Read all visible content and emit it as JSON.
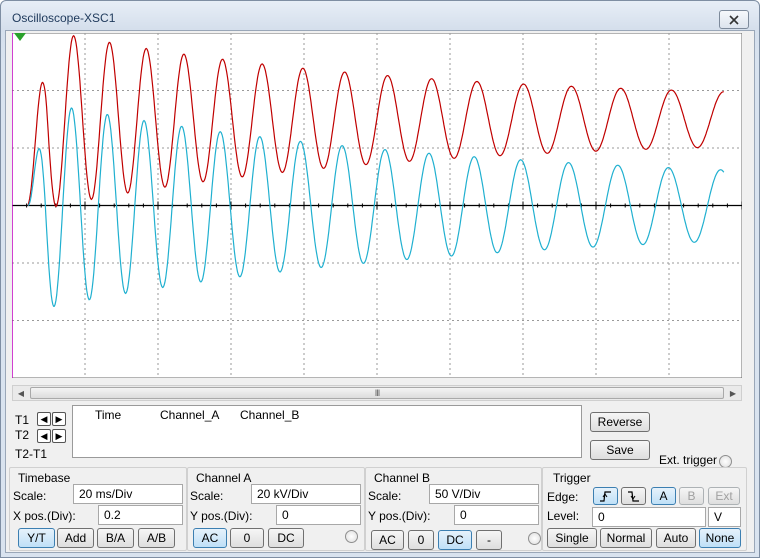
{
  "window": {
    "title": "Oscilloscope-XSC1"
  },
  "colors": {
    "channel_a": "#c00000",
    "channel_b": "#20b0d0",
    "trigger_marker": "#c000c0",
    "grid": "#9a9a9a",
    "screen_bg": "#ffffff"
  },
  "cursors": {
    "t1_label": "T1",
    "t2_label": "T2",
    "t2t1_label": "T2-T1"
  },
  "readout": {
    "col_time": "Time",
    "col_channel_a": "Channel_A",
    "col_channel_b": "Channel_B"
  },
  "buttons": {
    "reverse": "Reverse",
    "save": "Save",
    "ext_trigger": "Ext. trigger"
  },
  "timebase": {
    "title": "Timebase",
    "scale_label": "Scale:",
    "scale_value": "20 ms/Div",
    "xpos_label": "X pos.(Div):",
    "xpos_value": "0.2",
    "modes": [
      "Y/T",
      "Add",
      "B/A",
      "A/B"
    ],
    "active_mode": "Y/T"
  },
  "channel_a": {
    "title": "Channel A",
    "scale_label": "Scale:",
    "scale_value": "20 kV/Div",
    "ypos_label": "Y pos.(Div):",
    "ypos_value": "0",
    "coupling": [
      "AC",
      "0",
      "DC"
    ],
    "active_coupling": "AC"
  },
  "channel_b": {
    "title": "Channel B",
    "scale_label": "Scale:",
    "scale_value": "50  V/Div",
    "ypos_label": "Y pos.(Div):",
    "ypos_value": "0",
    "coupling": [
      "AC",
      "0",
      "DC",
      "-"
    ],
    "active_coupling": "DC"
  },
  "trigger": {
    "title": "Trigger",
    "edge_label": "Edge:",
    "level_label": "Level:",
    "level_value": "0",
    "level_unit": "V",
    "edge_rising_icon": "rising-edge-icon",
    "edge_falling_icon": "falling-edge-icon",
    "sources": [
      "A",
      "B",
      "Ext"
    ],
    "active_source": "A",
    "modes": [
      "Single",
      "Normal",
      "Auto",
      "None"
    ],
    "active_mode": "None"
  },
  "scrollbar": {
    "grip": "III"
  },
  "icons": {
    "close": "close-icon",
    "left_arrow": "arrow-left-icon",
    "right_arrow": "arrow-right-icon"
  },
  "chart_data": {
    "type": "line",
    "title": "",
    "xlabel": "",
    "ylabel": "",
    "grid": true,
    "x_divisions": 10,
    "y_divisions": 6,
    "series": [
      {
        "name": "Channel_A",
        "color": "#c00000",
        "description_points": {
          "x_div": [
            0.22,
            0.55,
            0.9,
            1.3,
            1.55,
            1.95,
            2.2,
            2.6,
            2.85,
            3.25,
            3.5,
            3.9,
            4.15,
            4.55,
            4.8,
            5.2,
            5.45,
            5.85,
            6.1,
            6.5,
            6.75,
            7.15,
            7.4,
            7.8,
            8.05,
            8.45,
            8.7,
            9.1,
            9.35,
            9.75
          ],
          "y_div": [
            0,
            2.8,
            0.2,
            2.6,
            0.6,
            2.4,
            0.8,
            2.3,
            0.9,
            2.2,
            1.0,
            2.1,
            1.1,
            2.0,
            1.15,
            1.95,
            1.2,
            1.9,
            1.25,
            1.85,
            1.3,
            1.8,
            1.3,
            1.75,
            1.35,
            1.7,
            1.35,
            1.7,
            1.4,
            1.5
          ]
        }
      },
      {
        "name": "Channel_B",
        "color": "#20b0d0",
        "description_points": {
          "x_div": [
            0.22,
            0.45,
            0.72,
            1.05,
            1.35,
            1.72,
            2.0,
            2.35,
            2.65,
            3.0,
            3.3,
            3.65,
            3.95,
            4.3,
            4.6,
            4.95,
            5.25,
            5.6,
            5.9,
            6.25,
            6.55,
            6.9,
            7.2,
            7.55,
            7.85,
            8.2,
            8.5,
            8.85,
            9.15,
            9.75
          ],
          "y_div": [
            0,
            1.6,
            -1.5,
            1.4,
            -1.3,
            1.3,
            -1.2,
            1.2,
            -1.1,
            1.0,
            -1.05,
            0.95,
            -0.98,
            0.9,
            -0.92,
            0.85,
            -0.85,
            0.8,
            -0.8,
            0.75,
            -0.75,
            0.7,
            -0.7,
            0.65,
            -0.65,
            0.6,
            -0.6,
            0.58,
            -0.55,
            0.5
          ]
        }
      }
    ]
  }
}
